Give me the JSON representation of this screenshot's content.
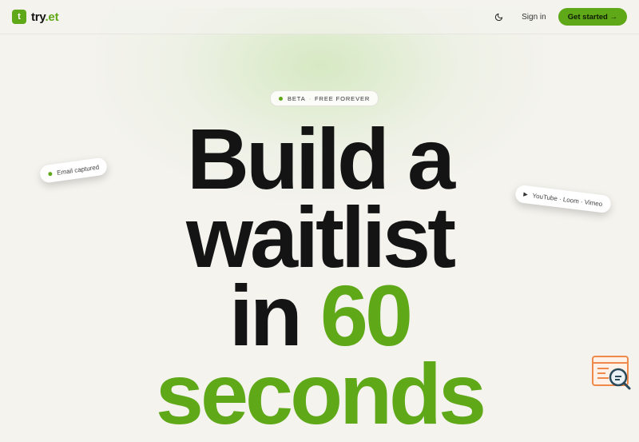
{
  "nav": {
    "logo_letter": "t",
    "brand_main": "try",
    "brand_dot": ".et",
    "signin_label": "Sign in",
    "cta_label": "Get started →",
    "theme_icon": "moon-icon"
  },
  "hero": {
    "badge_left": "BETA",
    "badge_sep": "·",
    "badge_right": "FREE FOREVER",
    "line1": "Build a",
    "line2": "waitlist",
    "line3_dark": "in",
    "line3_green": "60",
    "line4": "seconds"
  },
  "chips": {
    "email": "Email captured",
    "video": "YouTube · Loom · Vimeo"
  },
  "colors": {
    "accent": "#5fa818",
    "background": "#f4f3ee",
    "text": "#141414"
  }
}
